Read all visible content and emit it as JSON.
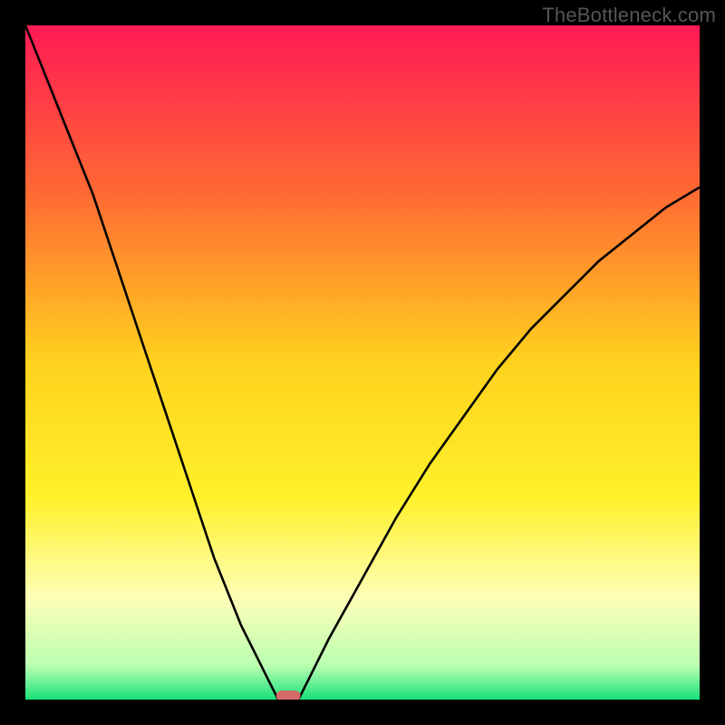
{
  "watermark": "TheBottleneck.com",
  "chart_data": {
    "type": "line",
    "title": "",
    "xlabel": "",
    "ylabel": "",
    "xlim": [
      0,
      100
    ],
    "ylim": [
      0,
      100
    ],
    "series": [
      {
        "name": "left-curve",
        "x": [
          0,
          2,
          4,
          6,
          8,
          10,
          12,
          14,
          16,
          18,
          20,
          22,
          24,
          26,
          28,
          30,
          32,
          34,
          36,
          37,
          37.5
        ],
        "y": [
          100,
          95,
          90,
          85,
          80,
          75,
          69,
          63,
          57,
          51,
          45,
          39,
          33,
          27,
          21,
          16,
          11,
          7,
          3,
          1,
          0
        ]
      },
      {
        "name": "right-curve",
        "x": [
          40.5,
          42,
          45,
          50,
          55,
          60,
          65,
          70,
          75,
          80,
          85,
          90,
          95,
          100
        ],
        "y": [
          0,
          3,
          9,
          18,
          27,
          35,
          42,
          49,
          55,
          60,
          65,
          69,
          73,
          76
        ]
      }
    ],
    "marker": {
      "name": "baseline-marker",
      "x_center": 39,
      "x_halfwidth": 1.8,
      "y": 0,
      "color": "#d46a6a"
    },
    "background_gradient": {
      "stops": [
        {
          "pos": 0.0,
          "color": "#ff1a54"
        },
        {
          "pos": 0.25,
          "color": "#ff6a33"
        },
        {
          "pos": 0.5,
          "color": "#ffd21e"
        },
        {
          "pos": 0.7,
          "color": "#fff12a"
        },
        {
          "pos": 0.85,
          "color": "#fdffb8"
        },
        {
          "pos": 0.95,
          "color": "#baffb0"
        },
        {
          "pos": 1.0,
          "color": "#18e07a"
        }
      ]
    }
  }
}
